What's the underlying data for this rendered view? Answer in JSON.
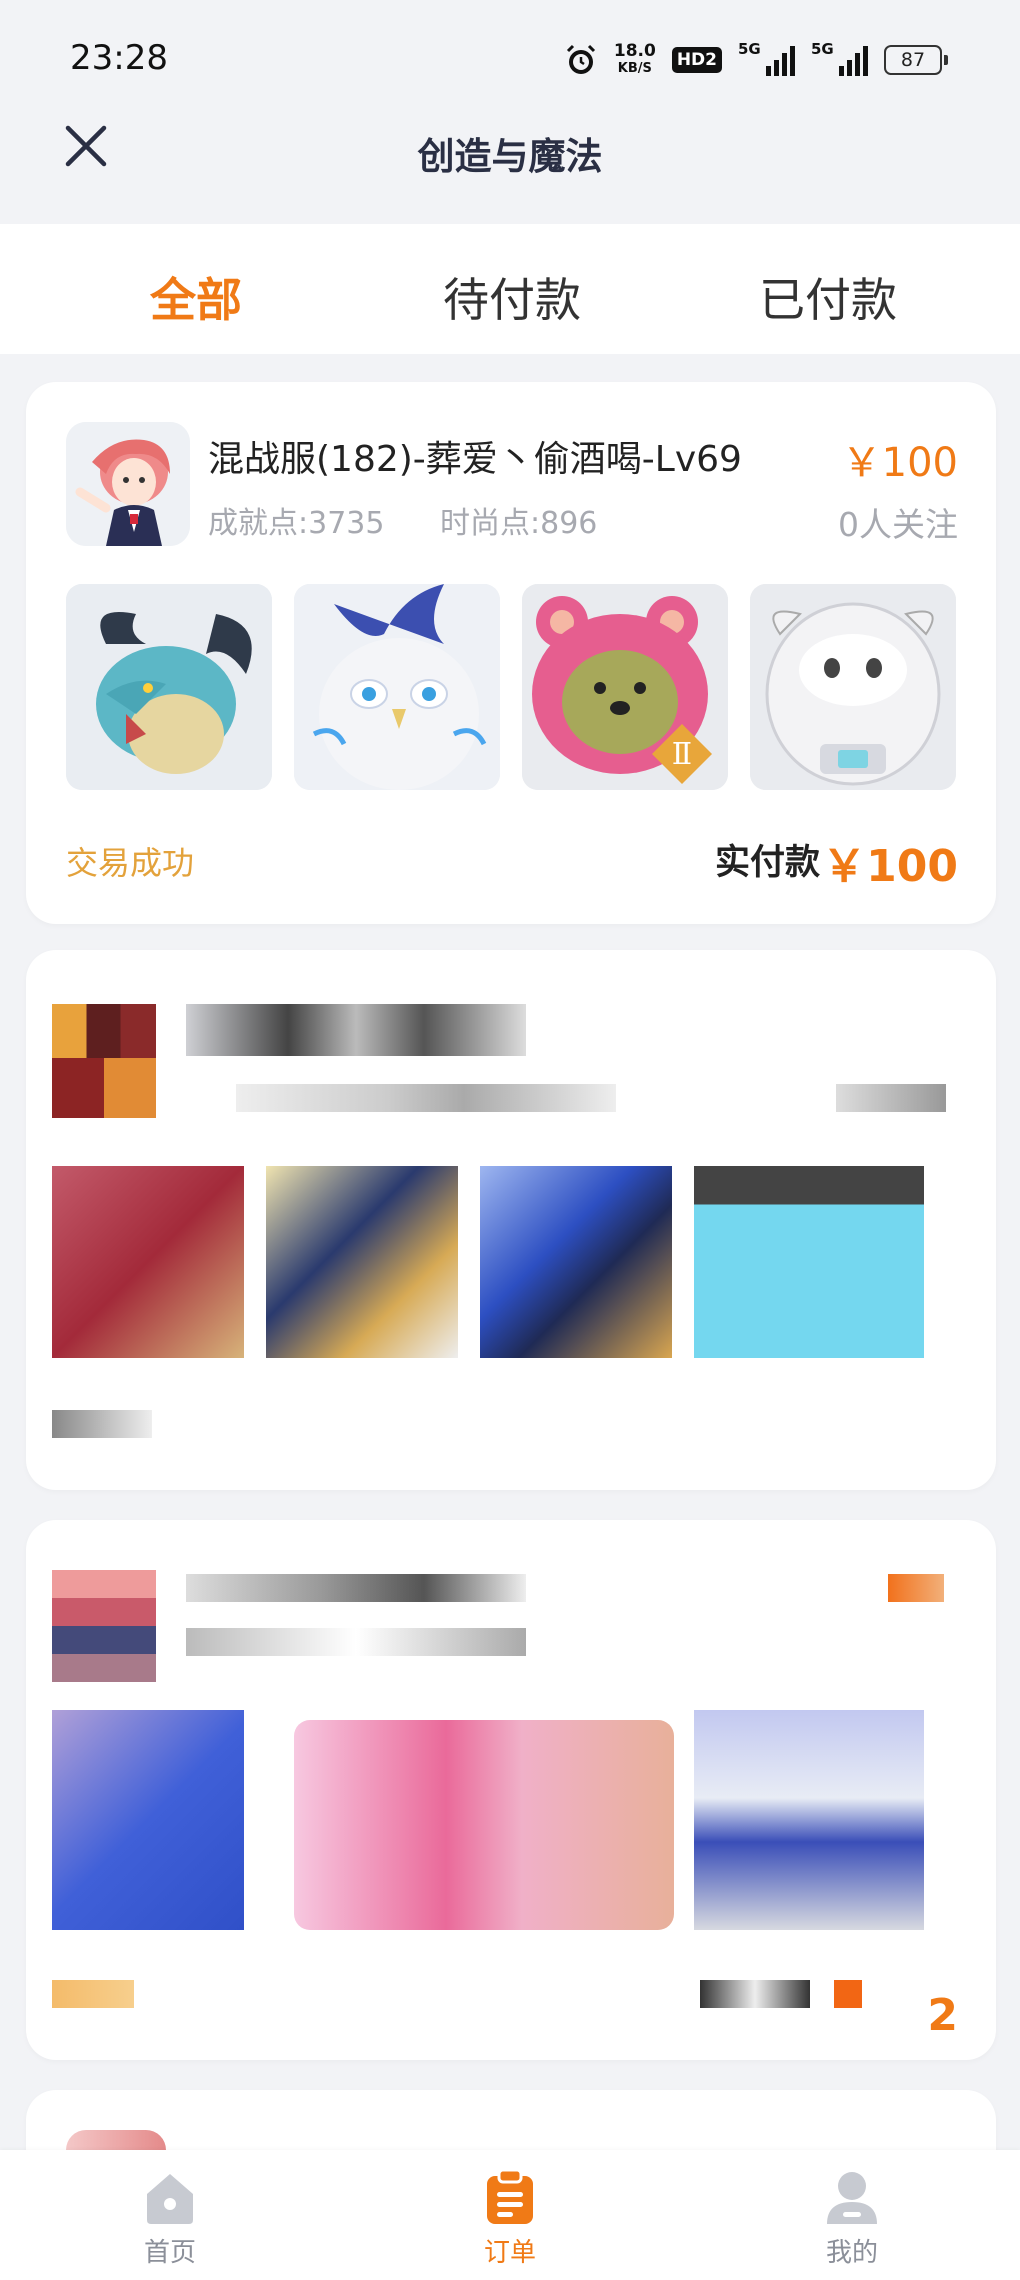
{
  "status_bar": {
    "time": "23:28",
    "net_speed": "18.0",
    "net_unit": "KB/S",
    "hd_badge": "HD2",
    "signal_1": "5G",
    "signal_2": "5G",
    "battery": "87"
  },
  "header": {
    "title": "创造与魔法",
    "close_icon": "close-icon"
  },
  "tabs": [
    {
      "label": "全部",
      "active": true
    },
    {
      "label": "待付款",
      "active": false
    },
    {
      "label": "已付款",
      "active": false
    }
  ],
  "orders": [
    {
      "title": "混战服(182)-葬爱丶偷酒喝-Lv69",
      "price": "￥100",
      "achievement": "成就点:3735",
      "fashion": "时尚点:896",
      "followers": "0人关注",
      "status": "交易成功",
      "paid_label": "实付款",
      "paid_value": "￥100",
      "thumbnails": [
        "dragon-mount",
        "white-owl-mount",
        "pink-bear-pet",
        "cow-astronaut-pet"
      ]
    }
  ],
  "blurred_card_2_count": "2",
  "bottom_nav": [
    {
      "label": "首页",
      "icon": "home-icon",
      "active": false
    },
    {
      "label": "订单",
      "icon": "order-icon",
      "active": true
    },
    {
      "label": "我的",
      "icon": "profile-icon",
      "active": false
    }
  ],
  "colors": {
    "accent": "#f07a16",
    "status_success": "#e3a23b",
    "muted": "#a7a9b0",
    "background": "#f2f3f6"
  }
}
